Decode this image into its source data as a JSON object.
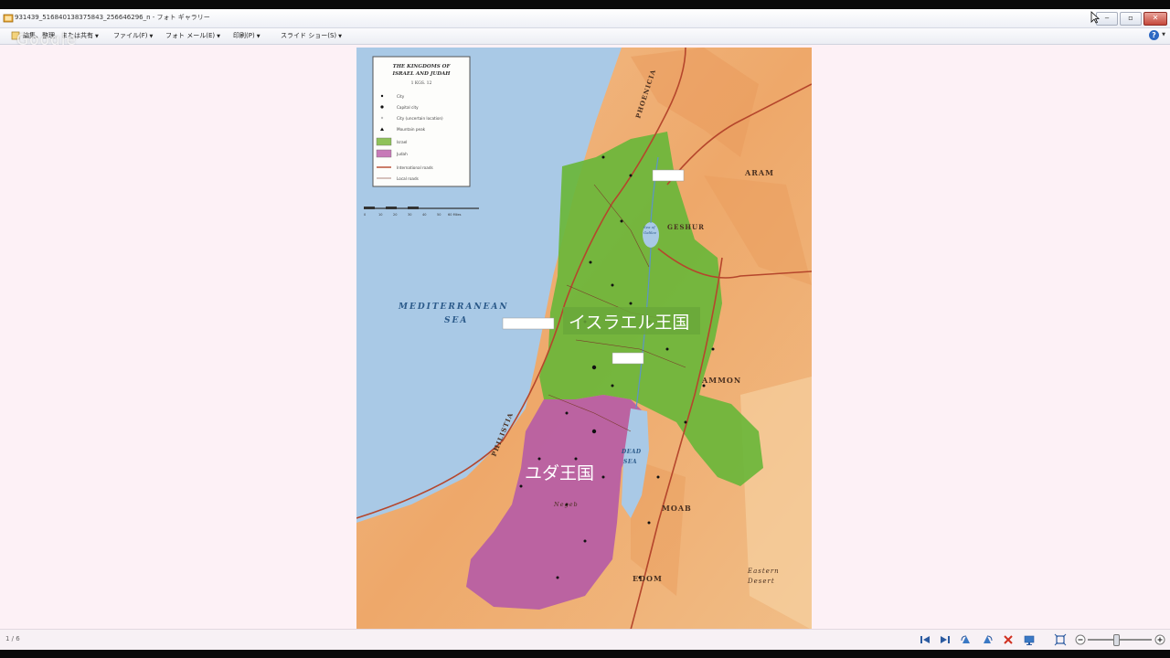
{
  "window": {
    "title": "931439_516840138375843_256646296_n - フォト ギャラリー",
    "controls": [
      "minimize",
      "maximize",
      "close"
    ]
  },
  "menubar": {
    "items": [
      {
        "label": "編集、整理、または共有",
        "icon": "organize-icon"
      },
      {
        "label": "ファイル(F)"
      },
      {
        "label": "フォト メール(E)"
      },
      {
        "label": "印刷(P)"
      },
      {
        "label": "スライド ショー(S)"
      }
    ],
    "help_label": "?",
    "watermark": "Google"
  },
  "map": {
    "legend": {
      "title_line1": "THE KINGDOMS OF",
      "title_line2": "ISRAEL AND JUDAH",
      "subtitle": "1 KGS. 12",
      "items": [
        "City",
        "Capital city",
        "City (uncertain location)",
        "Mountain peak",
        "Israel",
        "Judah",
        "International roads",
        "Local roads"
      ],
      "scale_numbers": [
        "0",
        "10",
        "20",
        "30",
        "40",
        "50",
        "60 Miles"
      ]
    },
    "regions": {
      "phoenicia": "PHOENICIA",
      "aram": "ARAM",
      "geshur": "GESHUR",
      "ammon": "AMMON",
      "moab": "MOAB",
      "edom": "EDOM",
      "philistia": "PHILISTIA",
      "negeb": "Negeb",
      "eastern_desert_1": "Eastern",
      "eastern_desert_2": "Desert",
      "sea_1": "MEDITERRANEAN",
      "sea_2": "SEA",
      "dead_sea_1": "DEAD",
      "dead_sea_2": "SEA",
      "sea_of_galilee_1": "Sea of",
      "sea_of_galilee_2": "Galilee"
    },
    "overlay_labels": {
      "israel": "イスラエル王国",
      "judah": "ユダ王国"
    },
    "colors": {
      "sea": "#a7c7e4",
      "land": "#f0b27a",
      "israel": "#6fb83a",
      "judah": "#b55ba6"
    }
  },
  "statusbar": {
    "page_counter": "1 / 6",
    "tools": [
      "previous-icon",
      "next-icon",
      "rotate-left-icon",
      "rotate-right-icon",
      "delete-icon",
      "slideshow-icon",
      "actual-size-icon",
      "zoom-out-icon",
      "zoom-slider",
      "zoom-in-icon"
    ]
  }
}
